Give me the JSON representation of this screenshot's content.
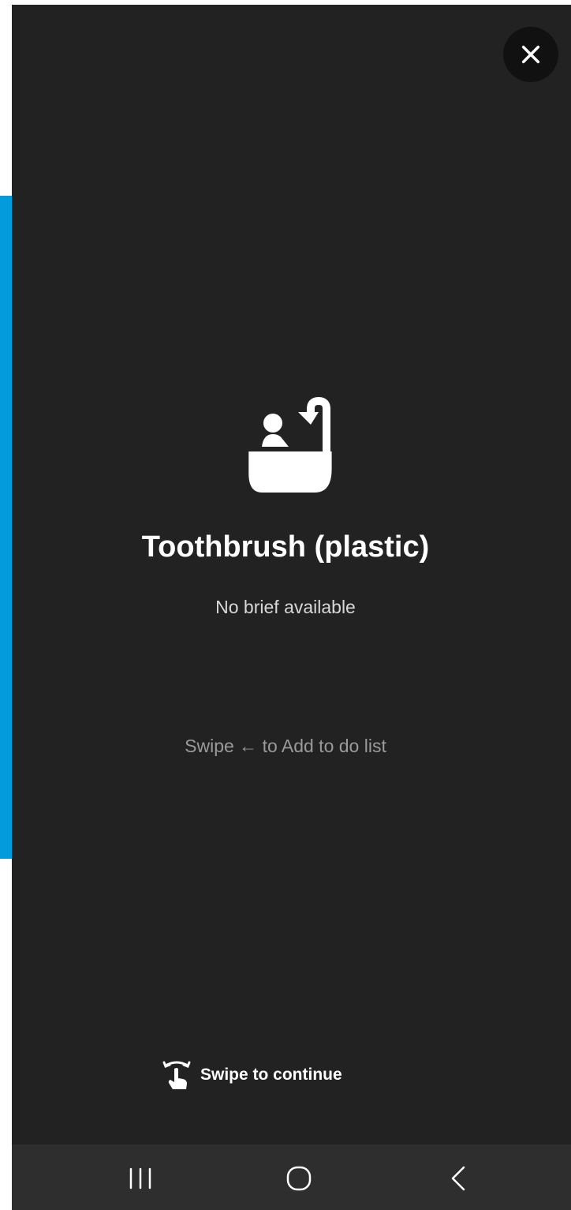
{
  "card": {
    "title": "Toothbrush (plastic)",
    "brief": "No brief available",
    "swipe_hint": "Swipe ← to Add to do list",
    "continue_label": "Swipe to continue"
  },
  "icons": {
    "close": "close-icon",
    "hero": "bathtub-icon",
    "swipe": "swipe-gesture-icon"
  },
  "nav_bar": {
    "recents": "recent-apps-icon",
    "home": "home-icon",
    "back": "back-icon"
  },
  "colors": {
    "accent": "#039bdc",
    "card_background": "#222222",
    "nav_background": "#2e2e2e"
  }
}
